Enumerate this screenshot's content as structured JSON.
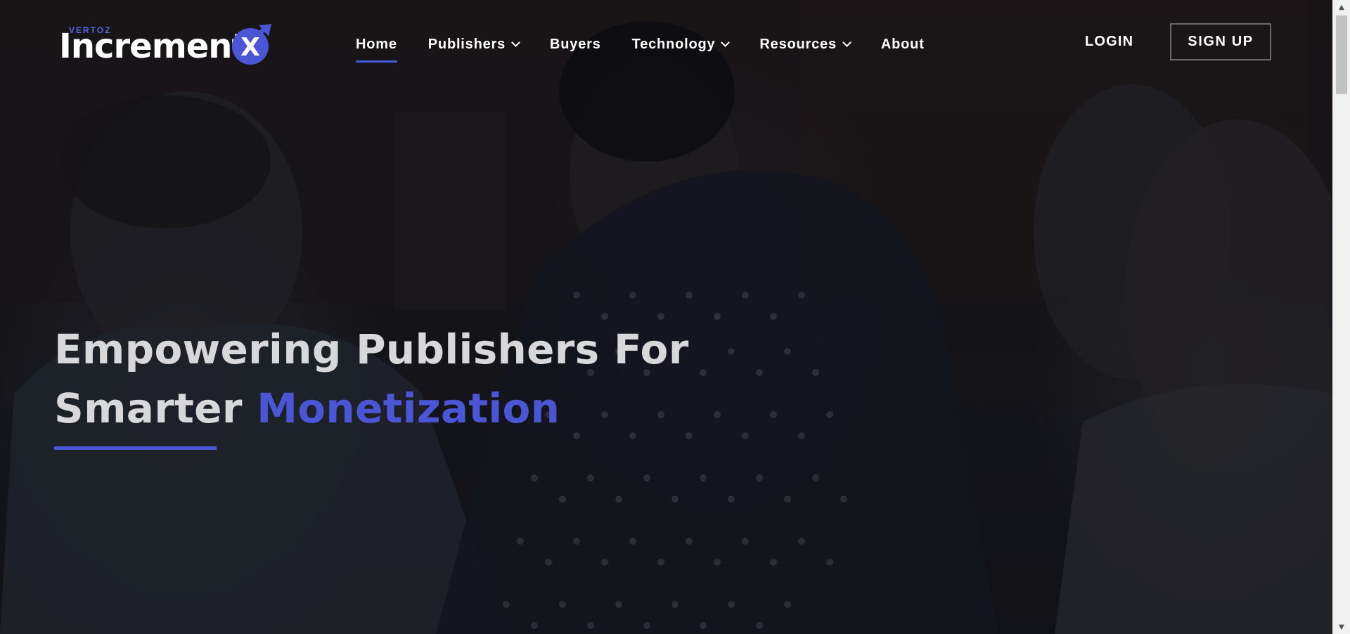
{
  "brand": {
    "small": "VERTOZ",
    "name": "Increment",
    "mark": "X",
    "accent_color": "#4a56d6"
  },
  "nav": {
    "items": [
      {
        "label": "Home",
        "active": true,
        "dropdown": false
      },
      {
        "label": "Publishers",
        "active": false,
        "dropdown": true
      },
      {
        "label": "Buyers",
        "active": false,
        "dropdown": false
      },
      {
        "label": "Technology",
        "active": false,
        "dropdown": true
      },
      {
        "label": "Resources",
        "active": false,
        "dropdown": true
      },
      {
        "label": "About",
        "active": false,
        "dropdown": false
      }
    ],
    "login_label": "LOGIN",
    "signup_label": "SIGN UP"
  },
  "hero": {
    "line1": "Empowering Publishers For",
    "line2_plain": "Smarter",
    "line2_accent": "Monetization"
  },
  "icons": {
    "dropdown": "chevron-down-icon",
    "scroll_up": "arrow-up-icon",
    "scroll_down": "arrow-down-icon"
  }
}
